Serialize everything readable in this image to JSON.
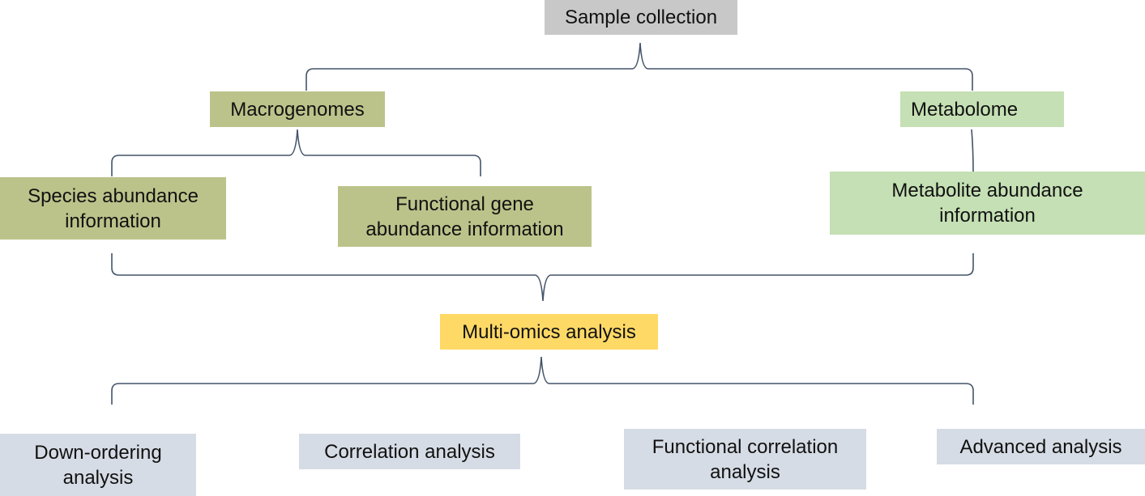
{
  "nodes": {
    "sample": {
      "label": "Sample collection",
      "color": "#c8c8c8"
    },
    "macro": {
      "label": "Macrogenomes",
      "color": "#bcc38a"
    },
    "metabolome": {
      "label": "Metabolome",
      "color": "#c5e0b4"
    },
    "species": {
      "line1": "Species abundance",
      "line2": "information",
      "color": "#bcc38a"
    },
    "functional_gene": {
      "line1": "Functional gene",
      "line2": "abundance information",
      "color": "#bcc38a"
    },
    "metabolite": {
      "line1": "Metabolite abundance",
      "line2": "information",
      "color": "#c5e0b4"
    },
    "multiomics": {
      "label": "Multi-omics analysis",
      "color": "#ffd966"
    },
    "down_ordering": {
      "line1": "Down-ordering",
      "line2": "analysis",
      "color": "#d6dce5"
    },
    "correlation": {
      "label": "Correlation analysis",
      "color": "#d6dce5"
    },
    "functional_correlation": {
      "line1": "Functional correlation",
      "line2": "analysis",
      "color": "#d6dce5"
    },
    "advanced": {
      "label": "Advanced analysis",
      "color": "#d6dce5"
    }
  },
  "connector_color": "#44546a"
}
